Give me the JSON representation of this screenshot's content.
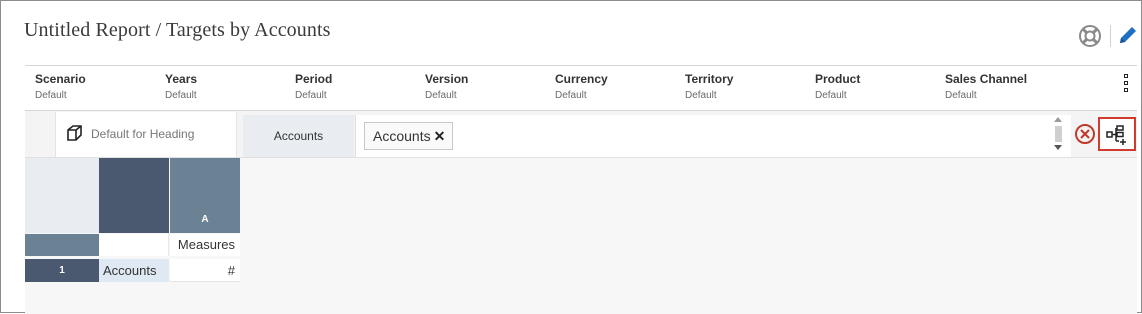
{
  "report": {
    "title": "Untitled Report / Targets by Accounts"
  },
  "header_icons": {
    "help": "lifebuoy-icon",
    "edit": "pencil-icon"
  },
  "pov": [
    {
      "name": "Scenario",
      "value": "Default"
    },
    {
      "name": "Years",
      "value": "Default"
    },
    {
      "name": "Period",
      "value": "Default"
    },
    {
      "name": "Version",
      "value": "Default"
    },
    {
      "name": "Currency",
      "value": "Default"
    },
    {
      "name": "Territory",
      "value": "Default"
    },
    {
      "name": "Product",
      "value": "Default"
    },
    {
      "name": "Sales Channel",
      "value": "Default"
    }
  ],
  "toolbar": {
    "style_label": "Default for Heading",
    "axis_tab": "Accounts",
    "chips": [
      {
        "label": "Accounts"
      }
    ],
    "remove_glyph": "✕"
  },
  "grid": {
    "column_header": "A",
    "measures_label": "Measures",
    "row_number": "1",
    "row_label": "Accounts",
    "cell_value": "#"
  },
  "colors": {
    "dark_header": "#4a5870",
    "col_header": "#6a8293",
    "highlight_border": "#d23a2e",
    "clear_icon": "#c0392b",
    "edit_icon": "#1f6fc5"
  }
}
